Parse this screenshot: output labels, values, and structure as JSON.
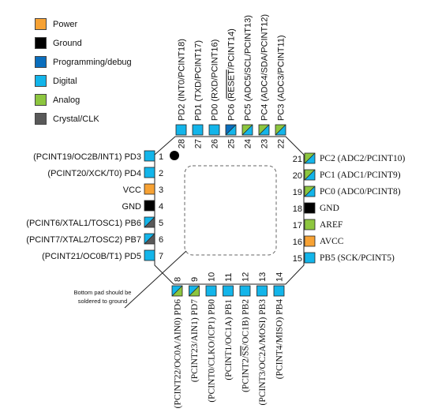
{
  "colors": {
    "power": "#f7a234",
    "ground": "#000000",
    "programming": "#0a6ebd",
    "digital": "#13b5ea",
    "analog": "#8dc63f",
    "crystal": "#595959"
  },
  "legend": [
    {
      "type": "power",
      "label": "Power"
    },
    {
      "type": "ground",
      "label": "Ground"
    },
    {
      "type": "programming",
      "label": "Programming/debug"
    },
    {
      "type": "digital",
      "label": "Digital"
    },
    {
      "type": "analog",
      "label": "Analog"
    },
    {
      "type": "crystal",
      "label": "Crystal/CLK"
    }
  ],
  "chip": {
    "package_marker": "pin-1-dot",
    "note": [
      "Bottom pad should be",
      "soldered to ground"
    ]
  },
  "pins": {
    "left": [
      {
        "num": "1",
        "label": "(PCINT19/OC2B/INT1) PD3",
        "fill": [
          "digital"
        ]
      },
      {
        "num": "2",
        "label": "(PCINT20/XCK/T0) PD4",
        "fill": [
          "digital"
        ]
      },
      {
        "num": "3",
        "label": "VCC",
        "fill": [
          "power"
        ]
      },
      {
        "num": "4",
        "label": "GND",
        "fill": [
          "ground"
        ]
      },
      {
        "num": "5",
        "label": "(PCINT6/XTAL1/TOSC1) PB6",
        "fill": [
          "digital",
          "crystal"
        ]
      },
      {
        "num": "6",
        "label": "(PCINT7/XTAL2/TOSC2) PB7",
        "fill": [
          "digital",
          "crystal"
        ]
      },
      {
        "num": "7",
        "label": "(PCINT21/OC0B/T1) PD5",
        "fill": [
          "digital"
        ]
      }
    ],
    "bottom": [
      {
        "num": "8",
        "label": "(PCINT22/OC0A/AIN0) PD6",
        "fill": [
          "digital",
          "analog"
        ]
      },
      {
        "num": "9",
        "label": "(PCINT23/AIN1) PD7",
        "fill": [
          "digital",
          "analog"
        ]
      },
      {
        "num": "10",
        "label": "(PCINT0/CLKO/ICP1) PB0",
        "fill": [
          "digital"
        ]
      },
      {
        "num": "11",
        "label": "(PCINT1/OC1A) PB1",
        "fill": [
          "digital"
        ]
      },
      {
        "num": "12",
        "label": "(PCINT2/SS/OC1B) PB2",
        "fill": [
          "digital"
        ],
        "overline": "SS"
      },
      {
        "num": "13",
        "label": "(PCINT3/OC2A/MOSI) PB3",
        "fill": [
          "digital"
        ]
      },
      {
        "num": "14",
        "label": "(PCINT4/MISO) PB4",
        "fill": [
          "digital"
        ]
      }
    ],
    "right": [
      {
        "num": "15",
        "label": "PB5 (SCK/PCINT5)",
        "fill": [
          "digital"
        ]
      },
      {
        "num": "16",
        "label": "AVCC",
        "fill": [
          "power"
        ]
      },
      {
        "num": "17",
        "label": "AREF",
        "fill": [
          "analog"
        ]
      },
      {
        "num": "18",
        "label": "GND",
        "fill": [
          "ground"
        ]
      },
      {
        "num": "19",
        "label": "PC0 (ADC0/PCINT8)",
        "fill": [
          "analog",
          "digital"
        ]
      },
      {
        "num": "20",
        "label": "PC1 (ADC1/PCINT9)",
        "fill": [
          "analog",
          "digital"
        ]
      },
      {
        "num": "21",
        "label": "PC2 (ADC2/PCINT10)",
        "fill": [
          "analog",
          "digital"
        ]
      }
    ],
    "top": [
      {
        "num": "22",
        "label": "PC3 (ADC3/PCINT11)",
        "fill": [
          "analog",
          "digital"
        ]
      },
      {
        "num": "23",
        "label": "PC4 (ADC4/SDA/PCINT12)",
        "fill": [
          "analog",
          "digital"
        ]
      },
      {
        "num": "24",
        "label": "PC5 (ADC5/SCL/PCINT13)",
        "fill": [
          "analog",
          "digital"
        ]
      },
      {
        "num": "25",
        "label": "PC6 (RESET/PCINT14)",
        "fill": [
          "programming",
          "digital"
        ],
        "overline": "RESET"
      },
      {
        "num": "26",
        "label": "PD0 (RXD/PCINT16)",
        "fill": [
          "digital"
        ]
      },
      {
        "num": "27",
        "label": "PD1 (TXD/PCINT17)",
        "fill": [
          "digital"
        ]
      },
      {
        "num": "28",
        "label": "PD2 (INT0/PCINT18)",
        "fill": [
          "digital"
        ]
      }
    ]
  }
}
